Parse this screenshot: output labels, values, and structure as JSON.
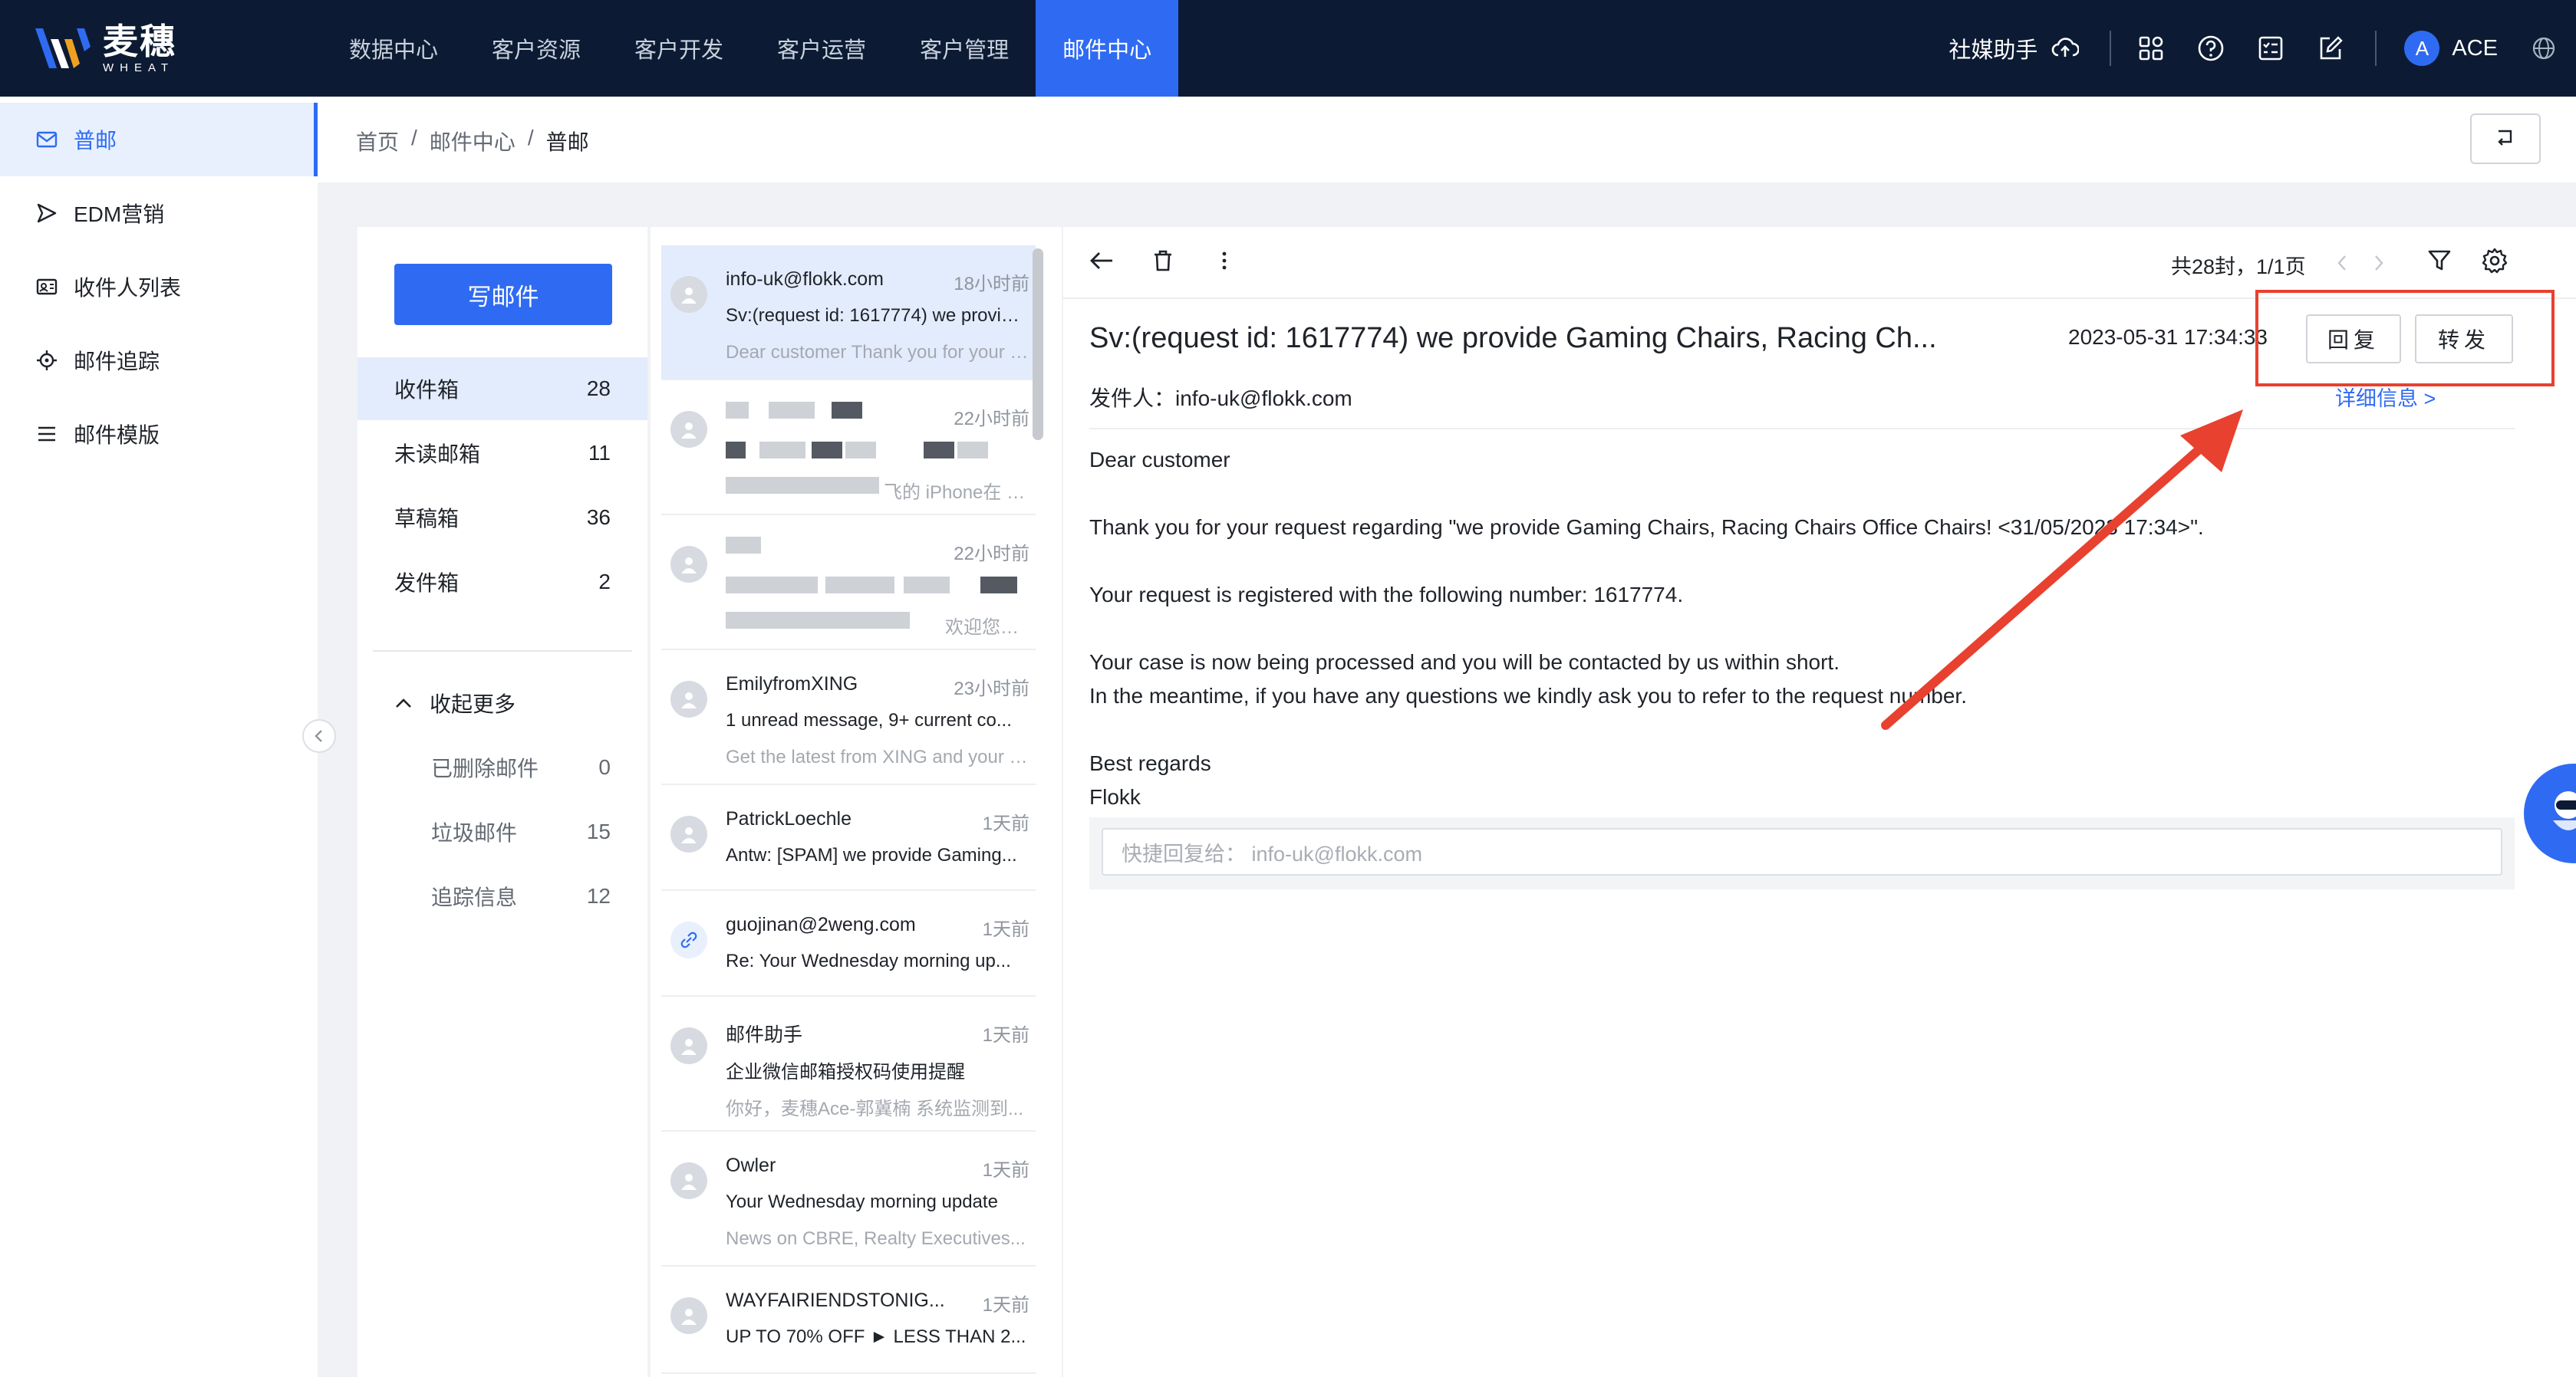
{
  "app": {
    "logo_cn": "麦穗",
    "logo_en": "WHEAT",
    "nav": [
      "数据中心",
      "客户资源",
      "客户开发",
      "客户运营",
      "客户管理",
      "邮件中心"
    ],
    "nav_active": "邮件中心",
    "social_helper": "社媒助手",
    "user_initial": "A",
    "user_name": "ACE"
  },
  "sidebar": {
    "items": [
      {
        "label": "普邮",
        "icon": "mail-icon"
      },
      {
        "label": "EDM营销",
        "icon": "send-icon"
      },
      {
        "label": "收件人列表",
        "icon": "contact-card-icon"
      },
      {
        "label": "邮件追踪",
        "icon": "target-icon"
      },
      {
        "label": "邮件模版",
        "icon": "list-icon"
      }
    ]
  },
  "breadcrumb": [
    "首页",
    "邮件中心",
    "普邮"
  ],
  "folders": {
    "compose": "写邮件",
    "items": [
      {
        "label": "收件箱",
        "count": "28"
      },
      {
        "label": "未读邮箱",
        "count": "11"
      },
      {
        "label": "草稿箱",
        "count": "36"
      },
      {
        "label": "发件箱",
        "count": "2"
      }
    ],
    "more": "收起更多",
    "sub": [
      {
        "label": "已删除邮件",
        "count": "0"
      },
      {
        "label": "垃圾邮件",
        "count": "15"
      },
      {
        "label": "追踪信息",
        "count": "12"
      }
    ]
  },
  "messages": [
    {
      "from": "info-uk@flokk.com",
      "time": "18小时前",
      "subject": "Sv:(request id: 1617774) we provide Gaming Chairs",
      "preview": "Dear customer Thank you for your request"
    },
    {
      "from": "",
      "time": "22小时前",
      "subject": "",
      "preview": "飞的 iPhone在 20..."
    },
    {
      "from": "",
      "time": "22小时前",
      "subject": "",
      "preview": "欢迎您参..."
    },
    {
      "from": "EmilyfromXING",
      "time": "23小时前",
      "subject": "1 unread message, 9+ current co...",
      "preview": "Get the latest from XING and your network"
    },
    {
      "from": "PatrickLoechle",
      "time": "1天前",
      "subject": "Antw: [SPAM] we provide Gaming...",
      "preview": ""
    },
    {
      "from": "guojinan@2weng.com",
      "time": "1天前",
      "subject": "Re: Your Wednesday morning up...",
      "preview": ""
    },
    {
      "from": "邮件助手",
      "time": "1天前",
      "subject": "企业微信邮箱授权码使用提醒",
      "preview": "你好，麦穗Ace-郭冀楠 系统监测到..."
    },
    {
      "from": "Owler",
      "time": "1天前",
      "subject": "Your Wednesday morning update",
      "preview": "News on CBRE, Realty Executives..."
    },
    {
      "from": "WAYFAIRIENDSTONIG...",
      "time": "1天前",
      "subject": "UP TO 70% OFF ► LESS THAN 2...",
      "preview": ""
    }
  ],
  "reader": {
    "page_info": "共28封，1/1页",
    "subject": "Sv:(request id: 1617774) we provide Gaming Chairs, Racing Ch...",
    "date": "2023-05-31 17:34:33",
    "reply": "回复",
    "forward": "转发",
    "sender_label": "发件人：",
    "sender": "info-uk@flokk.com",
    "details": "详细信息 >",
    "body": [
      "Dear customer",
      "Thank you for your request regarding \"we provide Gaming Chairs, Racing Chairs Office Chairs! <31/05/2023 17:34>\".",
      "Your request is registered with the following number: 1617774.",
      "Your case is now being processed and you will be contacted by us within short.",
      "In the meantime, if you have any questions we kindly ask you to refer to the request number.",
      "Best regards",
      "Flokk"
    ],
    "quick_reply_placeholder": "快捷回复给：   info-uk@flokk.com"
  },
  "colors": {
    "topbar": "#0c1b33",
    "accent": "#2f6bf2",
    "annotation": "#e8412f"
  }
}
